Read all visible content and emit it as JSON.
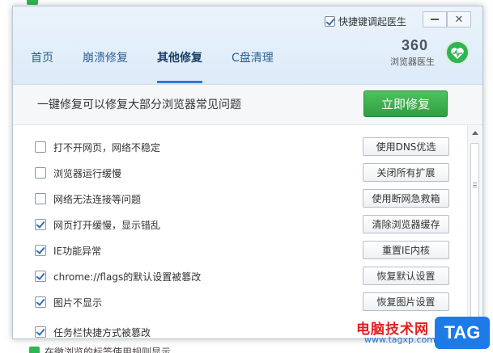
{
  "background": {
    "bottom_text": "在微浏览的标签使用规则显示"
  },
  "window": {
    "hotkey_label": "快捷键调起医生",
    "hotkey_checked": true,
    "minimize_label": "",
    "close_label": "✕"
  },
  "tabs": [
    {
      "label": "首页",
      "active": false
    },
    {
      "label": "崩溃修复",
      "active": false
    },
    {
      "label": "其他修复",
      "active": true
    },
    {
      "label": "C盘清理",
      "active": false
    }
  ],
  "logo": {
    "number": "360",
    "subtitle": "浏览器医生"
  },
  "banner": {
    "text": "一键修复可以修复大部分浏览器常见问题",
    "button_label": "立即修复"
  },
  "rows": [
    {
      "label": "打不开网页，网络不稳定",
      "checked": false,
      "action": "使用DNS优选"
    },
    {
      "label": "浏览器运行缓慢",
      "checked": false,
      "action": "关闭所有扩展"
    },
    {
      "label": "网络无法连接等问题",
      "checked": false,
      "action": "使用断网急救箱"
    },
    {
      "label": "网页打开缓慢，显示错乱",
      "checked": true,
      "action": "清除浏览器缓存"
    },
    {
      "label": "IE功能异常",
      "checked": true,
      "action": "重置IE内核"
    },
    {
      "label": "chrome://flags的默认设置被篡改",
      "checked": true,
      "action": "恢复默认设置"
    },
    {
      "label": "图片不显示",
      "checked": true,
      "action": "恢复图片设置"
    },
    {
      "label": "任务栏快捷方式被篡改",
      "checked": true,
      "action": ""
    }
  ],
  "watermark": {
    "text": "电脑技术网",
    "url": "www.tagxp.com",
    "tag": "TAG"
  },
  "colors": {
    "accent_green": "#2fb553",
    "tab_active": "#1a3f66",
    "tab_underline": "#2f7ad0",
    "watermark_red": "#e02020",
    "watermark_blue": "#1d7be8"
  }
}
